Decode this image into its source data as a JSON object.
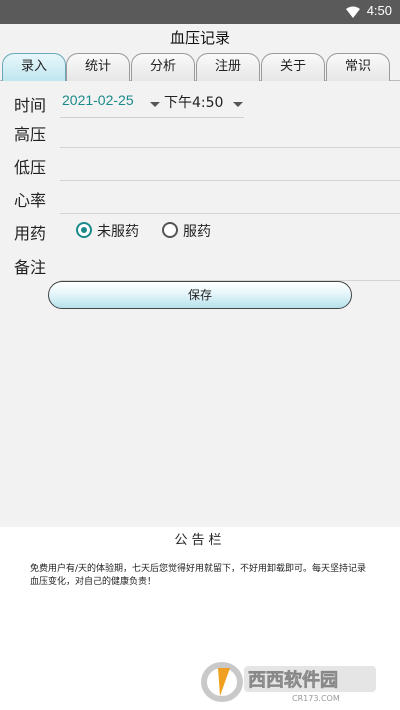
{
  "status": {
    "time": "4:50",
    "wifi_icon": "wifi-icon"
  },
  "app": {
    "title": "血压记录"
  },
  "tabs": [
    {
      "label": "录入",
      "active": true
    },
    {
      "label": "统计"
    },
    {
      "label": "分析"
    },
    {
      "label": "注册"
    },
    {
      "label": "关于"
    },
    {
      "label": "常识"
    }
  ],
  "form": {
    "time_label": "时间",
    "date_value": "2021-02-25",
    "time_value": "下午4:50",
    "systolic_label": "高压",
    "diastolic_label": "低压",
    "heart_rate_label": "心率",
    "medication_label": "用药",
    "no_med_label": "未服药",
    "med_label": "服药",
    "notes_label": "备注",
    "save_label": "保存"
  },
  "notice": {
    "title": "公告栏",
    "text": "免费用户有/天的体验期，七天后您觉得好用就留下，不好用卸载即可。每天坚持记录血压变化，对自己的健康负责！"
  },
  "watermark": {
    "brand": "西西软件园",
    "site": "CR173.COM"
  },
  "colors": {
    "accent": "#1a8a8a",
    "tab_active": "#bfe6ef"
  }
}
